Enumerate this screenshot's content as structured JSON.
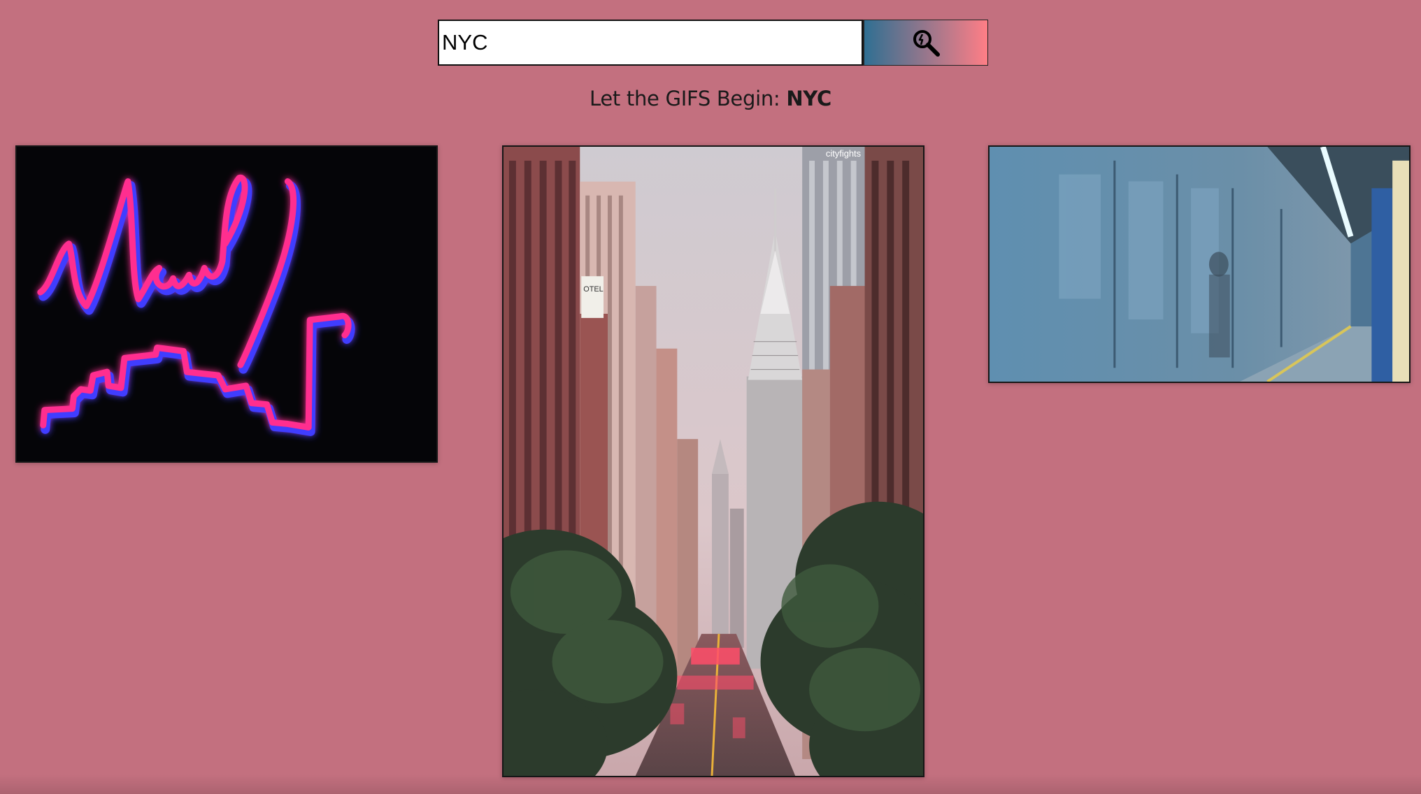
{
  "colors": {
    "page_background": "#c3707f",
    "search_button_gradient_start": "#2f6f92",
    "search_button_gradient_end": "#ff7e86"
  },
  "search": {
    "value": "NYC",
    "button_icon": "search-icon"
  },
  "heading": {
    "prefix": "Let the GIFS Begin: ",
    "term": "NYC"
  },
  "gifs": [
    {
      "icon": "neon-new-york-skyline-gif"
    },
    {
      "icon": "city-street-skyscrapers-gif",
      "watermark": "cityfights"
    },
    {
      "icon": "subway-train-platform-gif"
    }
  ]
}
